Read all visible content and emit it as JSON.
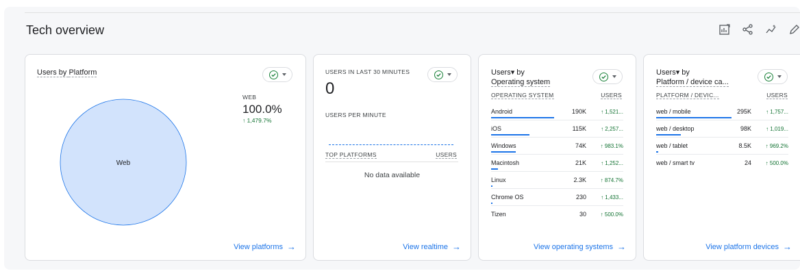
{
  "section": {
    "title": "Tech overview"
  },
  "tools": [
    "edit-chart-icon",
    "share-icon",
    "insights-icon",
    "pencil-icon"
  ],
  "platform_card": {
    "title_prefix": "Users by ",
    "title_dim": "Platform",
    "legend_label": "WEB",
    "legend_value": "100.0%",
    "legend_change": "↑ 1,479.7%",
    "pie_label": "Web",
    "footer": "View platforms",
    "chart_data": {
      "type": "pie",
      "categories": [
        "Web"
      ],
      "values": [
        100.0
      ],
      "colors": [
        "#d2e3fc"
      ]
    }
  },
  "realtime_card": {
    "title": "USERS IN LAST 30 MINUTES",
    "value": "0",
    "per_minute": "USERS PER MINUTE",
    "col_platform": "TOP PLATFORMS",
    "col_users": "USERS",
    "empty": "No data available",
    "footer": "View realtime"
  },
  "os_card": {
    "title_line1": "Users▾ by",
    "title_line2": "Operating system",
    "col_name": "OPERATING SYSTEM",
    "col_users": "USERS",
    "rows": [
      {
        "name": "Android",
        "users": "190K",
        "change": "↑ 1,521...",
        "share": 1.0
      },
      {
        "name": "iOS",
        "users": "115K",
        "change": "↑ 2,257...",
        "share": 0.605
      },
      {
        "name": "Windows",
        "users": "74K",
        "change": "↑ 983.1%",
        "share": 0.39
      },
      {
        "name": "Macintosh",
        "users": "21K",
        "change": "↑ 1,252...",
        "share": 0.11
      },
      {
        "name": "Linux",
        "users": "2.3K",
        "change": "↑ 874.7%",
        "share": 0.012
      },
      {
        "name": "Chrome OS",
        "users": "230",
        "change": "↑ 1,433...",
        "share": 0.003
      },
      {
        "name": "Tizen",
        "users": "30",
        "change": "↑ 500.0%",
        "share": 0.0
      }
    ],
    "footer": "View operating systems"
  },
  "device_card": {
    "title_line1": "Users▾ by",
    "title_line2": "Platform / device ca...",
    "col_name": "PLATFORM / DEVIC...",
    "col_users": "USERS",
    "rows": [
      {
        "name": "web / mobile",
        "users": "295K",
        "change": "↑ 1,757...",
        "share": 1.0
      },
      {
        "name": "web / desktop",
        "users": "98K",
        "change": "↑ 1,019...",
        "share": 0.33
      },
      {
        "name": "web / tablet",
        "users": "8.5K",
        "change": "↑ 969.2%",
        "share": 0.03
      },
      {
        "name": "web / smart tv",
        "users": "24",
        "change": "↑ 500.0%",
        "share": 0.0
      }
    ],
    "footer": "View platform devices"
  }
}
